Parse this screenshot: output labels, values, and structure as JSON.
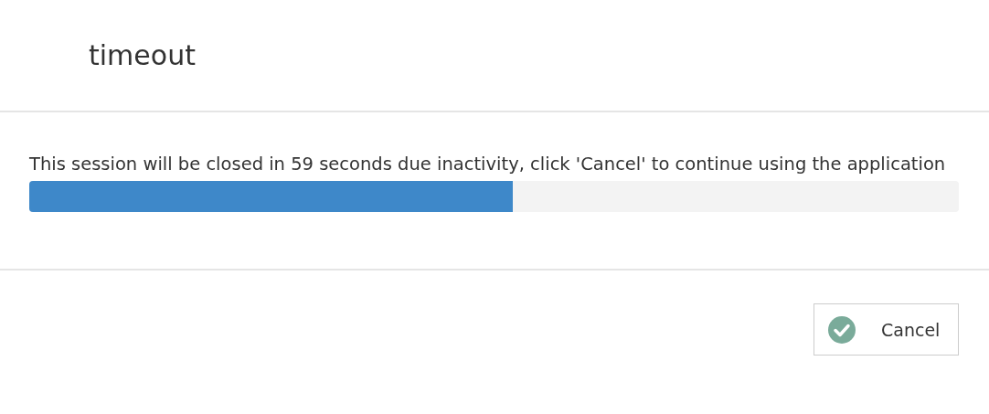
{
  "dialog": {
    "title": "timeout",
    "message": "This session will be closed in 59 seconds due inactivity, click 'Cancel' to continue using the application",
    "progress": {
      "level": 0.52
    },
    "buttons": [
      {
        "label": "Cancel",
        "kind": "confirm"
      }
    ]
  }
}
